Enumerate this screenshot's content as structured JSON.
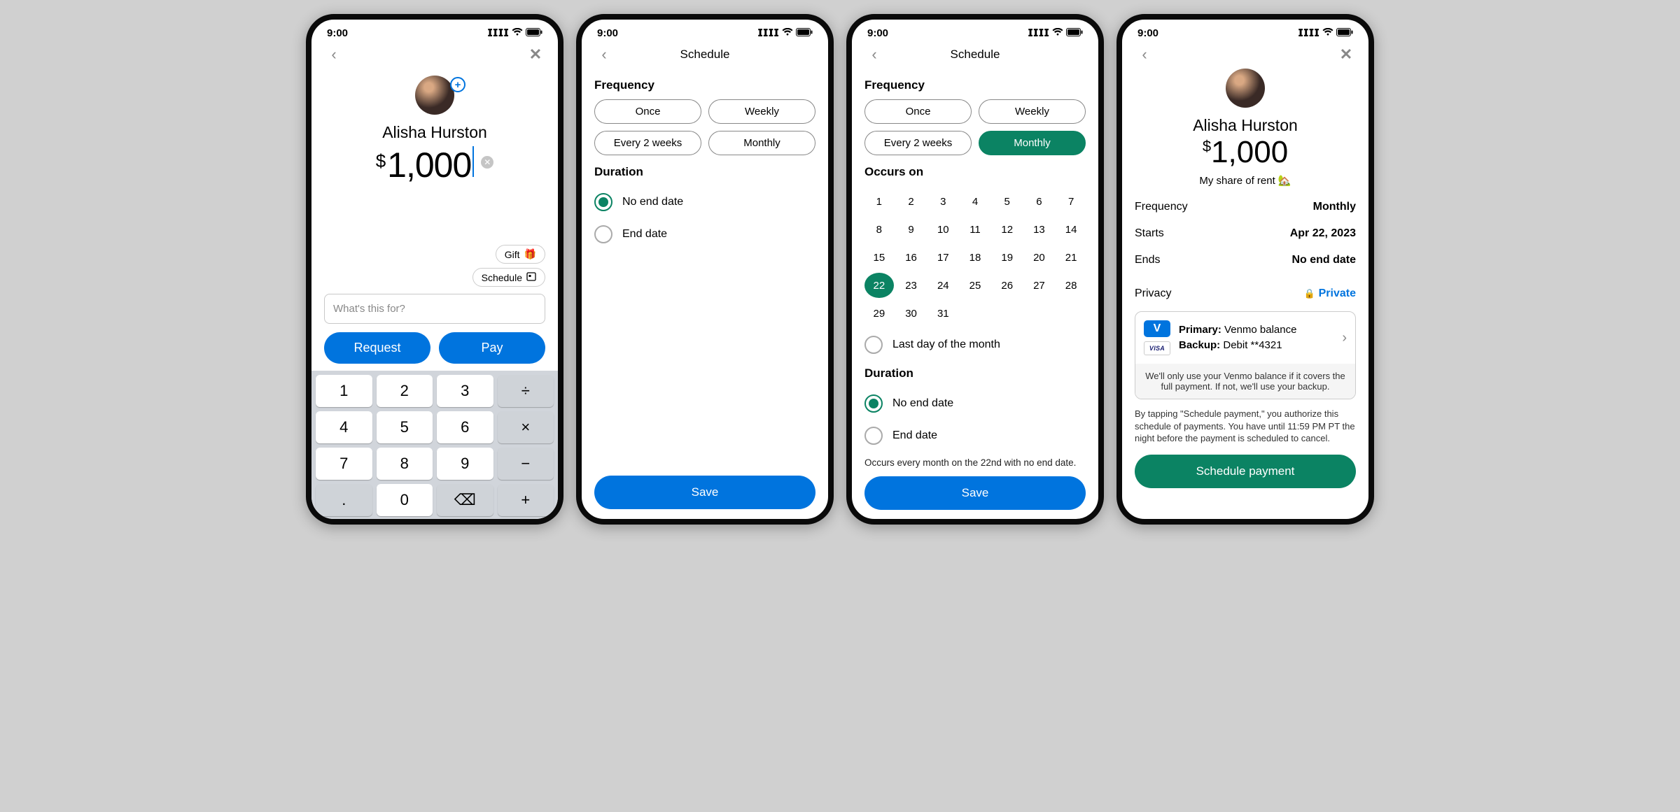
{
  "status": {
    "time": "9:00"
  },
  "recipient": {
    "name": "Alisha Hurston"
  },
  "screen1": {
    "currency": "$",
    "amount": "1,000",
    "gift_label": "Gift",
    "schedule_label": "Schedule",
    "note_placeholder": "What's this for?",
    "request_label": "Request",
    "pay_label": "Pay",
    "keys": [
      "1",
      "2",
      "3",
      "÷",
      "4",
      "5",
      "6",
      "×",
      "7",
      "8",
      "9",
      "−",
      ".",
      "0",
      "⌫",
      "+"
    ]
  },
  "screen2": {
    "title": "Schedule",
    "frequency_title": "Frequency",
    "freq_options": [
      "Once",
      "Weekly",
      "Every 2 weeks",
      "Monthly"
    ],
    "duration_title": "Duration",
    "no_end_label": "No end date",
    "end_label": "End date",
    "save_label": "Save"
  },
  "screen3": {
    "title": "Schedule",
    "frequency_title": "Frequency",
    "freq_options": [
      "Once",
      "Weekly",
      "Every 2 weeks",
      "Monthly"
    ],
    "freq_selected_index": 3,
    "occurs_title": "Occurs on",
    "selected_day": 22,
    "last_day_label": "Last day of the month",
    "duration_title": "Duration",
    "no_end_label": "No end date",
    "end_label": "End date",
    "summary": "Occurs every month on the 22nd with no end date.",
    "save_label": "Save"
  },
  "screen4": {
    "currency": "$",
    "amount": "1,000",
    "note": "My share of rent 🏡",
    "frequency_label": "Frequency",
    "frequency_value": "Monthly",
    "starts_label": "Starts",
    "starts_value": "Apr 22, 2023",
    "ends_label": "Ends",
    "ends_value": "No end date",
    "privacy_label": "Privacy",
    "privacy_value": "Private",
    "primary_label": "Primary:",
    "primary_value": "Venmo balance",
    "backup_label": "Backup:",
    "backup_value": "Debit **4321",
    "venmo_badge": "V",
    "visa_badge": "VISA",
    "pay_footer": "We'll only use your Venmo balance if it covers the full payment. If not, we'll use your backup.",
    "disclosure": "By tapping \"Schedule payment,\" you authorize this schedule of payments. You have until 11:59 PM PT the night before the payment is scheduled to cancel.",
    "schedule_label": "Schedule payment"
  }
}
